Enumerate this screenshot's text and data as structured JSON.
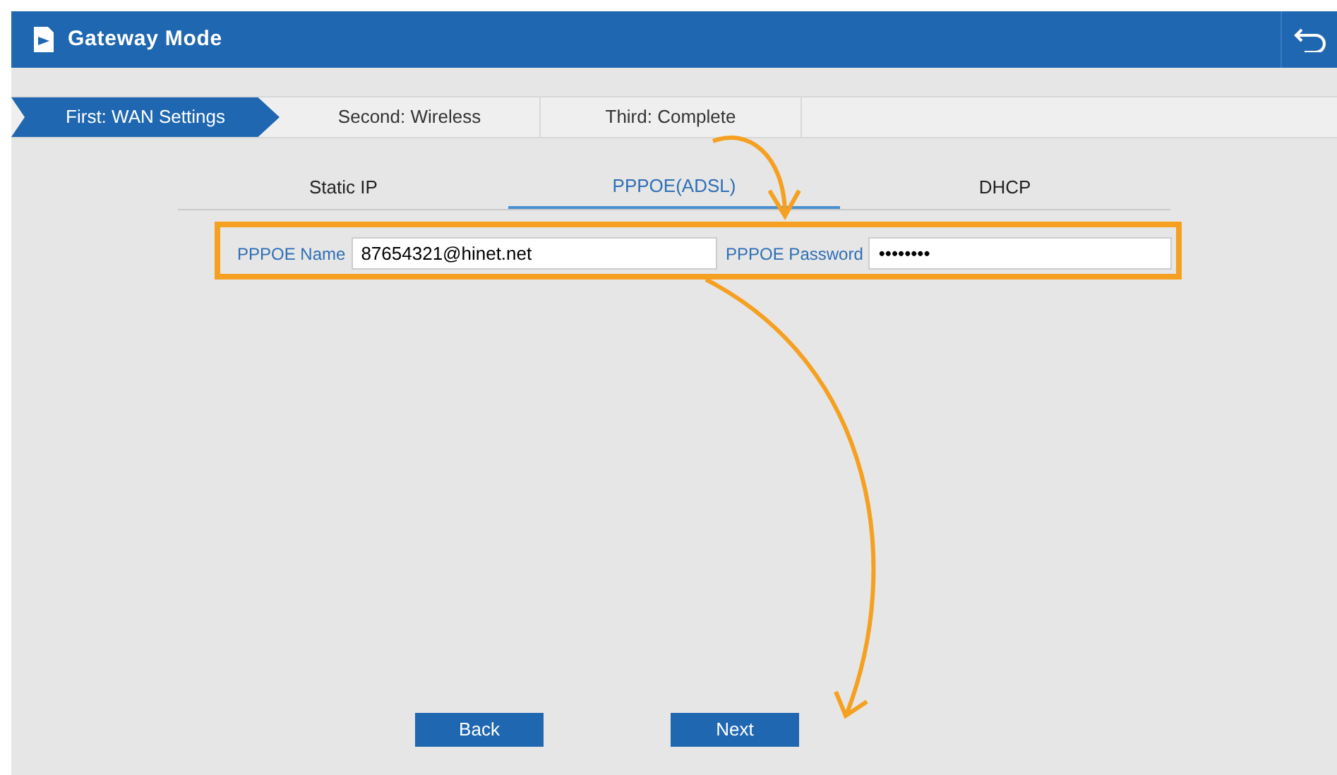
{
  "window": {
    "title": "Gateway Mode"
  },
  "steps": [
    {
      "label": "First: WAN Settings",
      "selected": true
    },
    {
      "label": "Second: Wireless",
      "selected": false
    },
    {
      "label": "Third: Complete",
      "selected": false
    }
  ],
  "tabs": [
    {
      "label": "Static IP",
      "selected": false
    },
    {
      "label": "PPPOE(ADSL)",
      "selected": true
    },
    {
      "label": "DHCP",
      "selected": false
    }
  ],
  "fields": [
    {
      "label": "PPPOE Name",
      "value": "87654321@hinet.net"
    },
    {
      "label": "PPPOE Password",
      "value": "••••••••"
    }
  ],
  "buttons": [
    "Back",
    "Next"
  ]
}
